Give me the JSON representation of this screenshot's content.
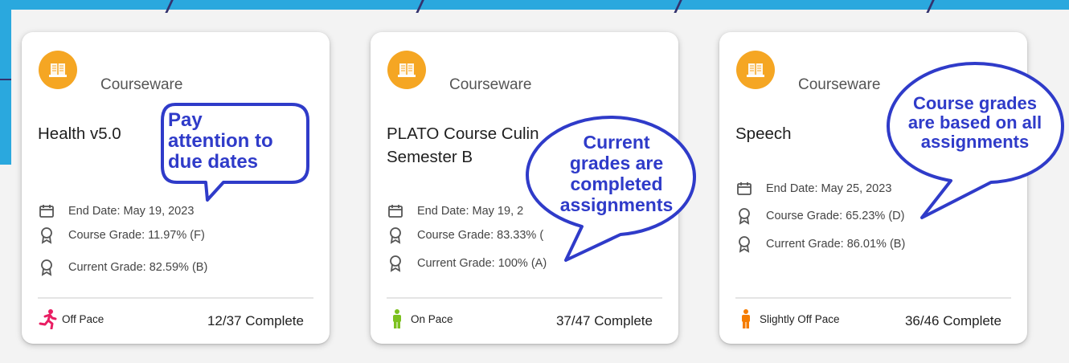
{
  "cards": [
    {
      "kind": "Courseware",
      "title": "Health v5.0",
      "end_date": "End Date: May 19, 2023",
      "course_grade": "Course Grade: 11.97% (F)",
      "current_grade": "Current Grade: 82.59% (B)",
      "pace": "Off Pace",
      "pace_color": "#e91e63",
      "complete": "12/37 Complete"
    },
    {
      "kind": "Courseware",
      "title_line1": "PLATO Course Culin",
      "title_line2": "Semester B",
      "end_date": "End Date: May 19, 2",
      "course_grade": "Course Grade: 83.33% (",
      "current_grade": "Current Grade: 100% (A)",
      "pace": "On Pace",
      "pace_color": "#7cc11f",
      "complete": "37/47 Complete"
    },
    {
      "kind": "Courseware",
      "title": "Speech",
      "end_date": "End Date: May 25, 2023",
      "course_grade": "Course Grade: 65.23% (D)",
      "current_grade": "Current Grade: 86.01% (B)",
      "pace": "Slightly Off Pace",
      "pace_color": "#f57c00",
      "complete": "36/46 Complete"
    }
  ],
  "callouts": {
    "due_dates": [
      "Pay",
      "attention to",
      "due dates"
    ],
    "current_grades": [
      "Current",
      "grades are",
      "completed",
      "assignments"
    ],
    "course_grades": [
      "Course grades",
      "are based on all",
      "assignments"
    ]
  },
  "colors": {
    "badge": "#f5a623",
    "callout_text": "#2f3bc9",
    "top_band": "#2aa8de"
  }
}
